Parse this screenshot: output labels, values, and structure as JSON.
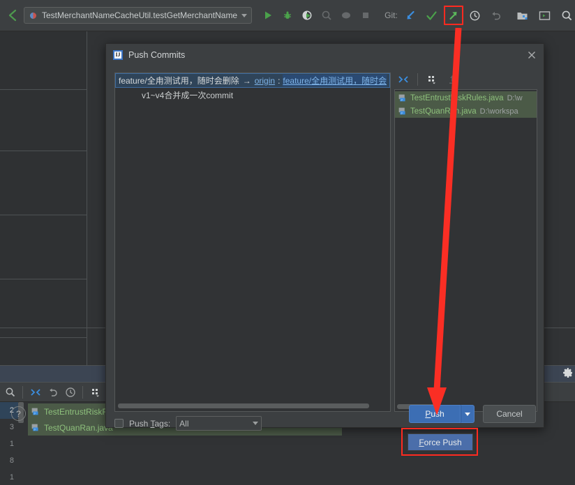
{
  "toolbar": {
    "back_icon": "back-arrow-icon",
    "run_config": {
      "label": "TestMerchantNameCacheUtil.testGetMerchantName",
      "dropdown_icon": "chevron-down-icon"
    },
    "actions": [
      {
        "name": "run-icon",
        "label": "Run"
      },
      {
        "name": "debug-icon",
        "label": "Debug"
      },
      {
        "name": "run-with-coverage-icon",
        "label": "Run with Coverage"
      },
      {
        "name": "profile-icon",
        "label": "Profile"
      },
      {
        "name": "attach-icon",
        "label": "Attach"
      },
      {
        "name": "stop-icon",
        "label": "Stop"
      }
    ],
    "git_label": "Git:",
    "git_actions": [
      {
        "name": "update-project-icon",
        "label": "Update Project",
        "color": "#3b8ee0"
      },
      {
        "name": "commit-icon",
        "label": "Commit",
        "color": "#4ba14b"
      },
      {
        "name": "push-icon",
        "label": "Push",
        "color": "#5bb85b",
        "highlighted": true
      },
      {
        "name": "history-icon",
        "label": "History"
      },
      {
        "name": "revert-icon",
        "label": "Revert"
      }
    ],
    "right_actions": [
      {
        "name": "project-structure-icon",
        "label": "Project Structure"
      },
      {
        "name": "terminal-icon",
        "label": "Terminal"
      },
      {
        "name": "search-everywhere-icon",
        "label": "Search Everywhere"
      }
    ]
  },
  "dialog": {
    "icon": "intellij-icon",
    "icon_text": "IJ",
    "title": "Push Commits",
    "close_icon": "close-icon",
    "branch_row": {
      "source": "feature/全甪测试用，随时会删除",
      "arrow": "→",
      "remote": "origin",
      "colon": ":",
      "target": "feature/全甪测试用，随时会"
    },
    "commits": [
      {
        "message": "v1~v4合并成一次commit"
      }
    ],
    "files_toolbar": [
      {
        "name": "collapse-expand-icon",
        "label": "Expand/Collapse"
      },
      {
        "name": "group-by-icon",
        "label": "Group By"
      },
      {
        "name": "show-diff-icon",
        "label": "Show Diff"
      }
    ],
    "files": [
      {
        "name": "TestEntrustRiskRules.java",
        "path": "D:\\w",
        "icon": "java-file-icon"
      },
      {
        "name": "TestQuanRan.java",
        "path": "D:\\workspa",
        "icon": "java-file-icon"
      }
    ],
    "push_tags": {
      "checkbox_checked": false,
      "label_pre": "Push ",
      "label_accel": "T",
      "label_post": "ags:",
      "combo_value": "All",
      "combo_icon": "chevron-down-icon"
    },
    "footer": {
      "help_label": "?",
      "help_icon": "help-icon",
      "push_accel": "P",
      "push_rest": "ush",
      "push_dropdown_icon": "chevron-down-icon",
      "cancel_label": "Cancel"
    },
    "force_push_popup": {
      "accel": "F",
      "rest": "orce Push",
      "highlighted": true
    }
  },
  "background": {
    "vcs_toolbar": [
      {
        "name": "search-icon",
        "label": "Search"
      },
      {
        "name": "collapse-expand-icon",
        "label": "Expand/Collapse"
      },
      {
        "name": "revert-icon",
        "label": "Revert"
      },
      {
        "name": "history-icon",
        "label": "History"
      },
      {
        "name": "group-by-icon",
        "label": "Group By"
      },
      {
        "name": "show-diff-icon",
        "label": "Show Diff"
      }
    ],
    "gutter_numbers": [
      "2",
      "3",
      "1",
      "8",
      "1"
    ],
    "files": [
      {
        "name": "TestEntrustRiskRul",
        "icon": "java-file-icon"
      },
      {
        "name": "TestQuanRan.java",
        "icon": "java-file-icon"
      }
    ],
    "settings_icon": "gear-icon"
  },
  "annotation": {
    "arrow_color": "#fa2e24",
    "highlight_color": "#ff2a20",
    "description": "red arrow from Push toolbar button down to Push dialog button"
  }
}
